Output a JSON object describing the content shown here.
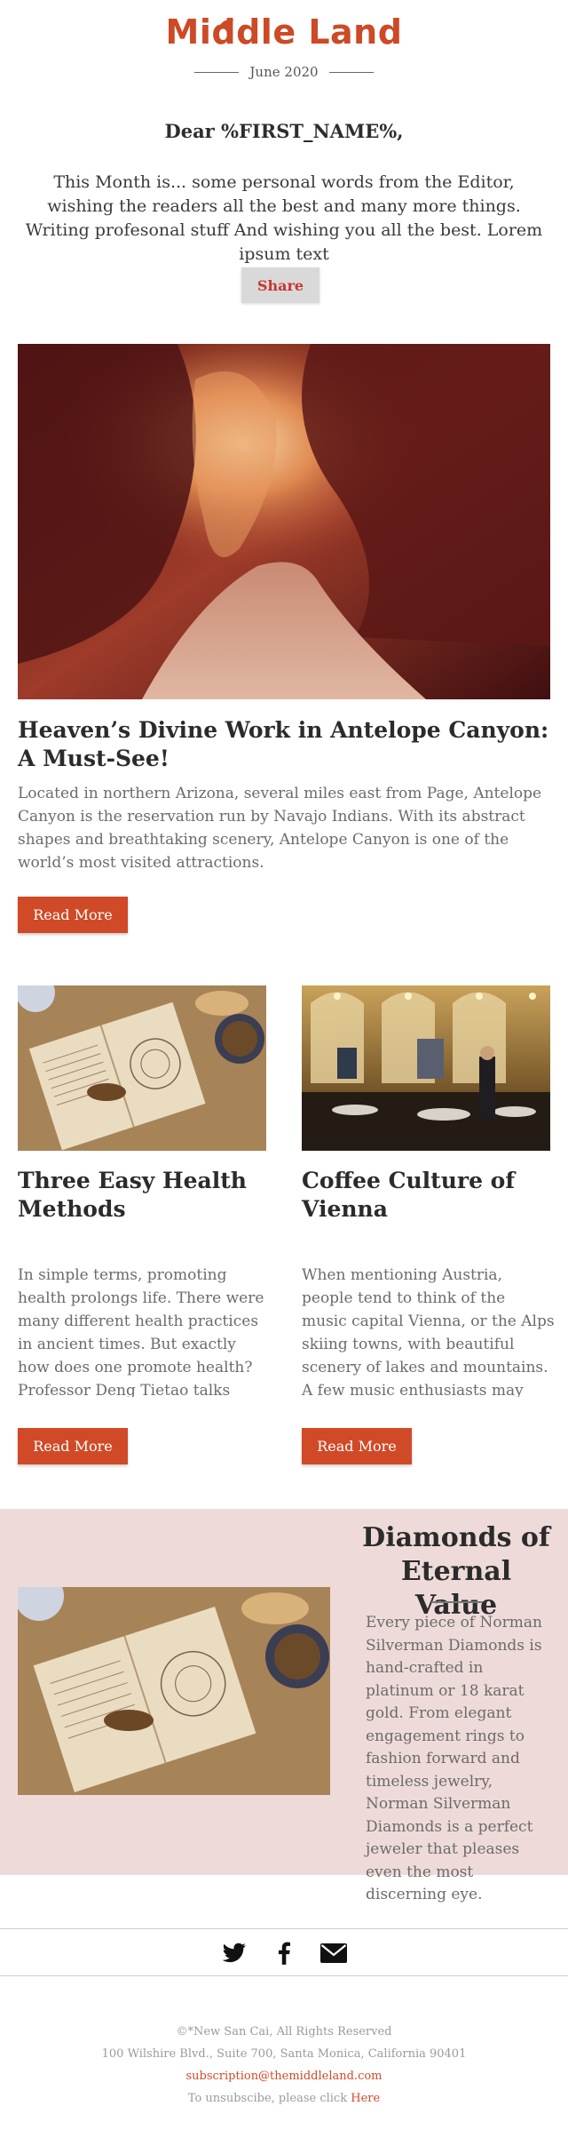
{
  "header": {
    "logo_text": "Middle Land",
    "date": "June 2020"
  },
  "greeting": "Dear %FIRST_NAME%,",
  "intro": "This Month is... some personal words from the Editor, wishing the readers all the best and many more things. Writing profesonal stuff And wishing you all the best. Lorem ipsum text",
  "share_label": "Share",
  "hero": {
    "title": "Heaven’s Divine Work in Antelope Canyon: A Must-See!",
    "text": "Located in northern Arizona, several miles east from Page, Antelope Canyon is the reservation run by Navajo Indians. With its abstract shapes and breathtaking scenery, Antelope Canyon is one of the world’s most visited attractions.",
    "button": "Read More"
  },
  "articles": [
    {
      "title": "Three Easy Health Methods",
      "text": "In simple terms, promoting health prolongs life. There were many different health practices in ancient times. But exactly how does one promote health? Professor Deng Tietao talks about",
      "button": "Read More"
    },
    {
      "title": "Coffee Culture of Vienna",
      "text": "When mentioning Austria, people tend to think of the music capital Vienna, or the Alps skiing towns, with beautiful scenery of lakes and mountains. A few music enthusiasts may also think of",
      "button": "Read More"
    }
  ],
  "feature": {
    "title": "Diamonds of Eternal Value",
    "text": "Every piece of Norman Silverman Diamonds is hand-crafted in platinum or 18 karat gold. From elegant engagement rings to fashion forward and timeless jewelry, Norman Silverman Diamonds is a perfect jeweler that pleases even the most discerning eye."
  },
  "social": {
    "icons": [
      "twitter-icon",
      "facebook-icon",
      "mail-icon"
    ]
  },
  "footer": {
    "copyright": "©*New San Cai, All Rights Reserved",
    "address": "100 Wilshire Blvd., Suite 700, Santa Monica, California 90401",
    "email": "subscription@themiddleland.com",
    "unsubscribe_text": "To unsubscibe, please click",
    "unsubscribe_link": "Here"
  },
  "colors": {
    "accent": "#d04a27",
    "feature_bg": "#eedbd9",
    "share_bg": "#d9d9d9"
  }
}
